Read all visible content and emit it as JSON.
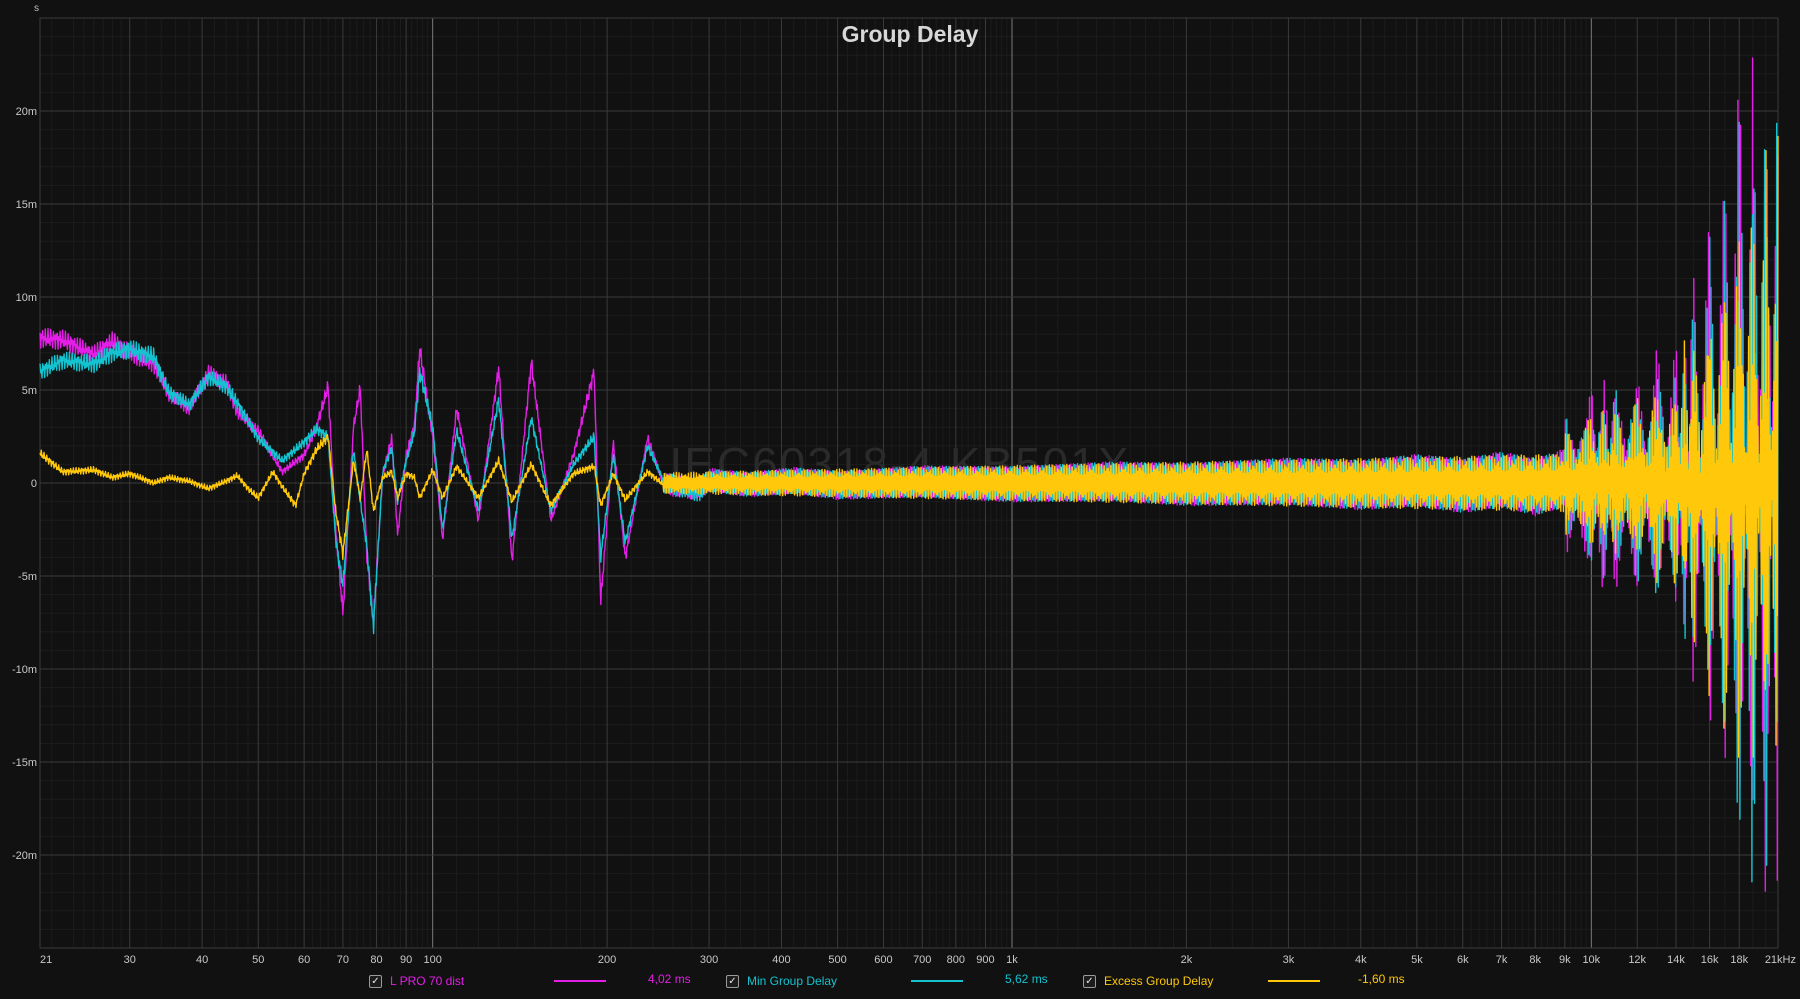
{
  "chart_data": {
    "type": "line",
    "title": "Group Delay",
    "watermark": "IEC60318-4 KB501X",
    "y_unit_label": "s",
    "x_scale": "log",
    "xlim": [
      21,
      21000
    ],
    "ylim": [
      -0.025,
      0.025
    ],
    "grid": true,
    "x_ticks": [
      {
        "value": 21,
        "label": "21"
      },
      {
        "value": 30,
        "label": "30"
      },
      {
        "value": 40,
        "label": "40"
      },
      {
        "value": 50,
        "label": "50"
      },
      {
        "value": 60,
        "label": "60"
      },
      {
        "value": 70,
        "label": "70"
      },
      {
        "value": 80,
        "label": "80"
      },
      {
        "value": 90,
        "label": "90"
      },
      {
        "value": 100,
        "label": "100"
      },
      {
        "value": 200,
        "label": "200"
      },
      {
        "value": 300,
        "label": "300"
      },
      {
        "value": 400,
        "label": "400"
      },
      {
        "value": 500,
        "label": "500"
      },
      {
        "value": 600,
        "label": "600"
      },
      {
        "value": 700,
        "label": "700"
      },
      {
        "value": 800,
        "label": "800"
      },
      {
        "value": 900,
        "label": "900"
      },
      {
        "value": 1000,
        "label": "1k"
      },
      {
        "value": 2000,
        "label": "2k"
      },
      {
        "value": 3000,
        "label": "3k"
      },
      {
        "value": 4000,
        "label": "4k"
      },
      {
        "value": 5000,
        "label": "5k"
      },
      {
        "value": 6000,
        "label": "6k"
      },
      {
        "value": 7000,
        "label": "7k"
      },
      {
        "value": 8000,
        "label": "8k"
      },
      {
        "value": 9000,
        "label": "9k"
      },
      {
        "value": 10000,
        "label": "10k"
      },
      {
        "value": 12000,
        "label": "12k"
      },
      {
        "value": 14000,
        "label": "14k"
      },
      {
        "value": 16000,
        "label": "16k"
      },
      {
        "value": 18000,
        "label": "18k"
      },
      {
        "value": 21000,
        "label": "21kHz"
      }
    ],
    "y_ticks": [
      {
        "value": 0.02,
        "label": "20m"
      },
      {
        "value": 0.015,
        "label": "15m"
      },
      {
        "value": 0.01,
        "label": "10m"
      },
      {
        "value": 0.005,
        "label": "5m"
      },
      {
        "value": 0,
        "label": "0"
      },
      {
        "value": -0.005,
        "label": "-5m"
      },
      {
        "value": -0.01,
        "label": "-10m"
      },
      {
        "value": -0.015,
        "label": "-15m"
      },
      {
        "value": -0.02,
        "label": "-20m"
      }
    ],
    "series": [
      {
        "name": "L PRO 70 dist",
        "color": "#e31ee6",
        "checked": true,
        "value_label": "4,02 ms",
        "points": [
          [
            21,
            7.8
          ],
          [
            23,
            7.7
          ],
          [
            26,
            6.9
          ],
          [
            28,
            7.6
          ],
          [
            30,
            7.0
          ],
          [
            33,
            6.4
          ],
          [
            35,
            4.8
          ],
          [
            38,
            4.0
          ],
          [
            41,
            5.9
          ],
          [
            44,
            5.4
          ],
          [
            46,
            3.8
          ],
          [
            50,
            2.8
          ],
          [
            55,
            0.6
          ],
          [
            60,
            1.5
          ],
          [
            63,
            3.0
          ],
          [
            66,
            5.2
          ],
          [
            68,
            -2.5
          ],
          [
            70,
            -7.0
          ],
          [
            73,
            3.0
          ],
          [
            75,
            5.1
          ],
          [
            77,
            -4.0
          ],
          [
            79,
            -7.5
          ],
          [
            82,
            0.5
          ],
          [
            85,
            2.4
          ],
          [
            87,
            -2.8
          ],
          [
            90,
            1.5
          ],
          [
            93,
            3.1
          ],
          [
            95,
            7.2
          ],
          [
            100,
            2.5
          ],
          [
            104,
            -3.0
          ],
          [
            110,
            4.0
          ],
          [
            120,
            -2.0
          ],
          [
            130,
            6.2
          ],
          [
            137,
            -4.2
          ],
          [
            148,
            6.5
          ],
          [
            160,
            -2.0
          ],
          [
            175,
            1.5
          ],
          [
            190,
            6.0
          ],
          [
            195,
            -6.4
          ],
          [
            205,
            2.2
          ],
          [
            215,
            -4.0
          ],
          [
            235,
            2.4
          ],
          [
            260,
            -1.5
          ],
          [
            290,
            -3.4
          ],
          [
            300,
            2.0
          ],
          [
            350,
            -1.0
          ],
          [
            420,
            1.5
          ],
          [
            500,
            -1.5
          ],
          [
            700,
            0.9
          ],
          [
            1000,
            -0.8
          ],
          [
            1500,
            1.0
          ],
          [
            2000,
            -0.9
          ],
          [
            3000,
            1.0
          ],
          [
            4000,
            -1.2
          ],
          [
            5000,
            1.6
          ],
          [
            6000,
            -1.8
          ],
          [
            7000,
            2.2
          ],
          [
            8000,
            -2.5
          ],
          [
            9000,
            3.0
          ],
          [
            10000,
            -4.0
          ],
          [
            10500,
            5.5
          ],
          [
            11000,
            -5.0
          ],
          [
            12000,
            5.0
          ],
          [
            13000,
            -6.5
          ],
          [
            14000,
            7.0
          ],
          [
            14500,
            -8.5
          ],
          [
            15000,
            12.0
          ],
          [
            16000,
            -15.0
          ],
          [
            17000,
            18.0
          ],
          [
            18000,
            -24.0
          ],
          [
            19000,
            24.0
          ],
          [
            20000,
            -24.0
          ],
          [
            21000,
            24.0
          ]
        ]
      },
      {
        "name": "Min Group Delay",
        "color": "#14c3cf",
        "checked": true,
        "value_label": "5,62 ms",
        "points": [
          [
            21,
            6.0
          ],
          [
            23,
            6.6
          ],
          [
            26,
            6.4
          ],
          [
            28,
            7.0
          ],
          [
            30,
            7.2
          ],
          [
            33,
            6.8
          ],
          [
            35,
            4.9
          ],
          [
            38,
            4.2
          ],
          [
            41,
            5.7
          ],
          [
            44,
            5.2
          ],
          [
            46,
            4.3
          ],
          [
            50,
            2.4
          ],
          [
            55,
            1.2
          ],
          [
            60,
            2.2
          ],
          [
            63,
            2.9
          ],
          [
            66,
            2.5
          ],
          [
            68,
            -3.0
          ],
          [
            70,
            -5.5
          ],
          [
            73,
            1.8
          ],
          [
            75,
            -1.0
          ],
          [
            77,
            -3.4
          ],
          [
            79,
            -7.8
          ],
          [
            82,
            0.6
          ],
          [
            85,
            1.9
          ],
          [
            87,
            -1.0
          ],
          [
            90,
            1.2
          ],
          [
            93,
            2.7
          ],
          [
            95,
            6.0
          ],
          [
            100,
            3.0
          ],
          [
            104,
            -2.5
          ],
          [
            110,
            2.8
          ],
          [
            120,
            -1.5
          ],
          [
            130,
            4.5
          ],
          [
            137,
            -3.0
          ],
          [
            148,
            3.5
          ],
          [
            160,
            -1.5
          ],
          [
            175,
            1.0
          ],
          [
            190,
            2.5
          ],
          [
            195,
            -4.0
          ],
          [
            205,
            1.5
          ],
          [
            215,
            -3.2
          ],
          [
            235,
            2.0
          ],
          [
            260,
            -1.0
          ],
          [
            290,
            -4.2
          ],
          [
            300,
            1.5
          ],
          [
            350,
            -0.8
          ],
          [
            420,
            1.2
          ],
          [
            500,
            -1.0
          ],
          [
            700,
            0.7
          ],
          [
            1000,
            -0.6
          ],
          [
            1500,
            0.8
          ],
          [
            2000,
            -0.7
          ],
          [
            3000,
            0.9
          ],
          [
            4000,
            -0.9
          ],
          [
            5000,
            1.3
          ],
          [
            6000,
            -1.5
          ],
          [
            7000,
            1.8
          ],
          [
            8000,
            -2.0
          ],
          [
            9000,
            2.5
          ],
          [
            10000,
            -3.0
          ],
          [
            10500,
            4.0
          ],
          [
            11000,
            -4.2
          ],
          [
            12000,
            4.5
          ],
          [
            13000,
            -5.5
          ],
          [
            14000,
            5.5
          ],
          [
            14500,
            -8.0
          ],
          [
            15000,
            10.0
          ],
          [
            16000,
            -13.0
          ],
          [
            17000,
            16.0
          ],
          [
            18000,
            -22.0
          ],
          [
            19000,
            24.0
          ],
          [
            20000,
            -24.0
          ],
          [
            21000,
            24.0
          ]
        ]
      },
      {
        "name": "Excess Group Delay",
        "color": "#ffc80a",
        "checked": true,
        "value_label": "-1,60 ms",
        "points": [
          [
            21,
            1.6
          ],
          [
            23,
            0.6
          ],
          [
            26,
            0.7
          ],
          [
            28,
            0.3
          ],
          [
            30,
            0.5
          ],
          [
            33,
            0.0
          ],
          [
            35,
            0.3
          ],
          [
            38,
            0.1
          ],
          [
            41,
            -0.3
          ],
          [
            44,
            0.1
          ],
          [
            46,
            0.4
          ],
          [
            48,
            -0.3
          ],
          [
            50,
            -0.8
          ],
          [
            53,
            0.6
          ],
          [
            55,
            -0.2
          ],
          [
            58,
            -1.2
          ],
          [
            60,
            0.5
          ],
          [
            63,
            1.8
          ],
          [
            66,
            2.5
          ],
          [
            68,
            -1.5
          ],
          [
            70,
            -3.8
          ],
          [
            73,
            1.2
          ],
          [
            75,
            -0.8
          ],
          [
            77,
            1.8
          ],
          [
            79,
            -1.5
          ],
          [
            82,
            0.3
          ],
          [
            85,
            0.6
          ],
          [
            87,
            -0.8
          ],
          [
            90,
            0.5
          ],
          [
            93,
            0.3
          ],
          [
            95,
            -0.8
          ],
          [
            100,
            0.7
          ],
          [
            104,
            -0.8
          ],
          [
            110,
            0.9
          ],
          [
            120,
            -0.8
          ],
          [
            130,
            1.2
          ],
          [
            137,
            -1.0
          ],
          [
            148,
            1.0
          ],
          [
            160,
            -1.2
          ],
          [
            175,
            0.5
          ],
          [
            190,
            0.9
          ],
          [
            195,
            -1.2
          ],
          [
            205,
            0.5
          ],
          [
            215,
            -0.9
          ],
          [
            235,
            0.6
          ],
          [
            260,
            -0.5
          ],
          [
            290,
            0.8
          ],
          [
            300,
            -0.5
          ],
          [
            350,
            0.5
          ],
          [
            420,
            -0.5
          ],
          [
            500,
            0.4
          ],
          [
            700,
            -0.4
          ],
          [
            1000,
            0.4
          ],
          [
            1500,
            -0.4
          ],
          [
            2000,
            0.5
          ],
          [
            3000,
            -0.5
          ],
          [
            4000,
            0.6
          ],
          [
            5000,
            -0.8
          ],
          [
            6000,
            0.9
          ],
          [
            7000,
            -1.0
          ],
          [
            8000,
            1.2
          ],
          [
            9000,
            -1.8
          ],
          [
            10000,
            2.5
          ],
          [
            10500,
            -2.8
          ],
          [
            11000,
            3.0
          ],
          [
            12000,
            -3.5
          ],
          [
            13000,
            4.5
          ],
          [
            14000,
            -5.0
          ],
          [
            14500,
            7.0
          ],
          [
            15000,
            -9.0
          ],
          [
            16000,
            11.0
          ],
          [
            17000,
            -14.0
          ],
          [
            18000,
            16.0
          ],
          [
            19000,
            -17.0
          ],
          [
            20000,
            18.0
          ],
          [
            21000,
            -20.0
          ]
        ]
      }
    ]
  },
  "legend": [
    {
      "label": "L PRO 70 dist",
      "value": "4,02 ms",
      "color": "#e31ee6",
      "checked": true
    },
    {
      "label": "Min Group Delay",
      "value": "5,62 ms",
      "color": "#14c3cf",
      "checked": true
    },
    {
      "label": "Excess Group Delay",
      "value": "-1,60 ms",
      "color": "#ffc80a",
      "checked": true
    }
  ]
}
